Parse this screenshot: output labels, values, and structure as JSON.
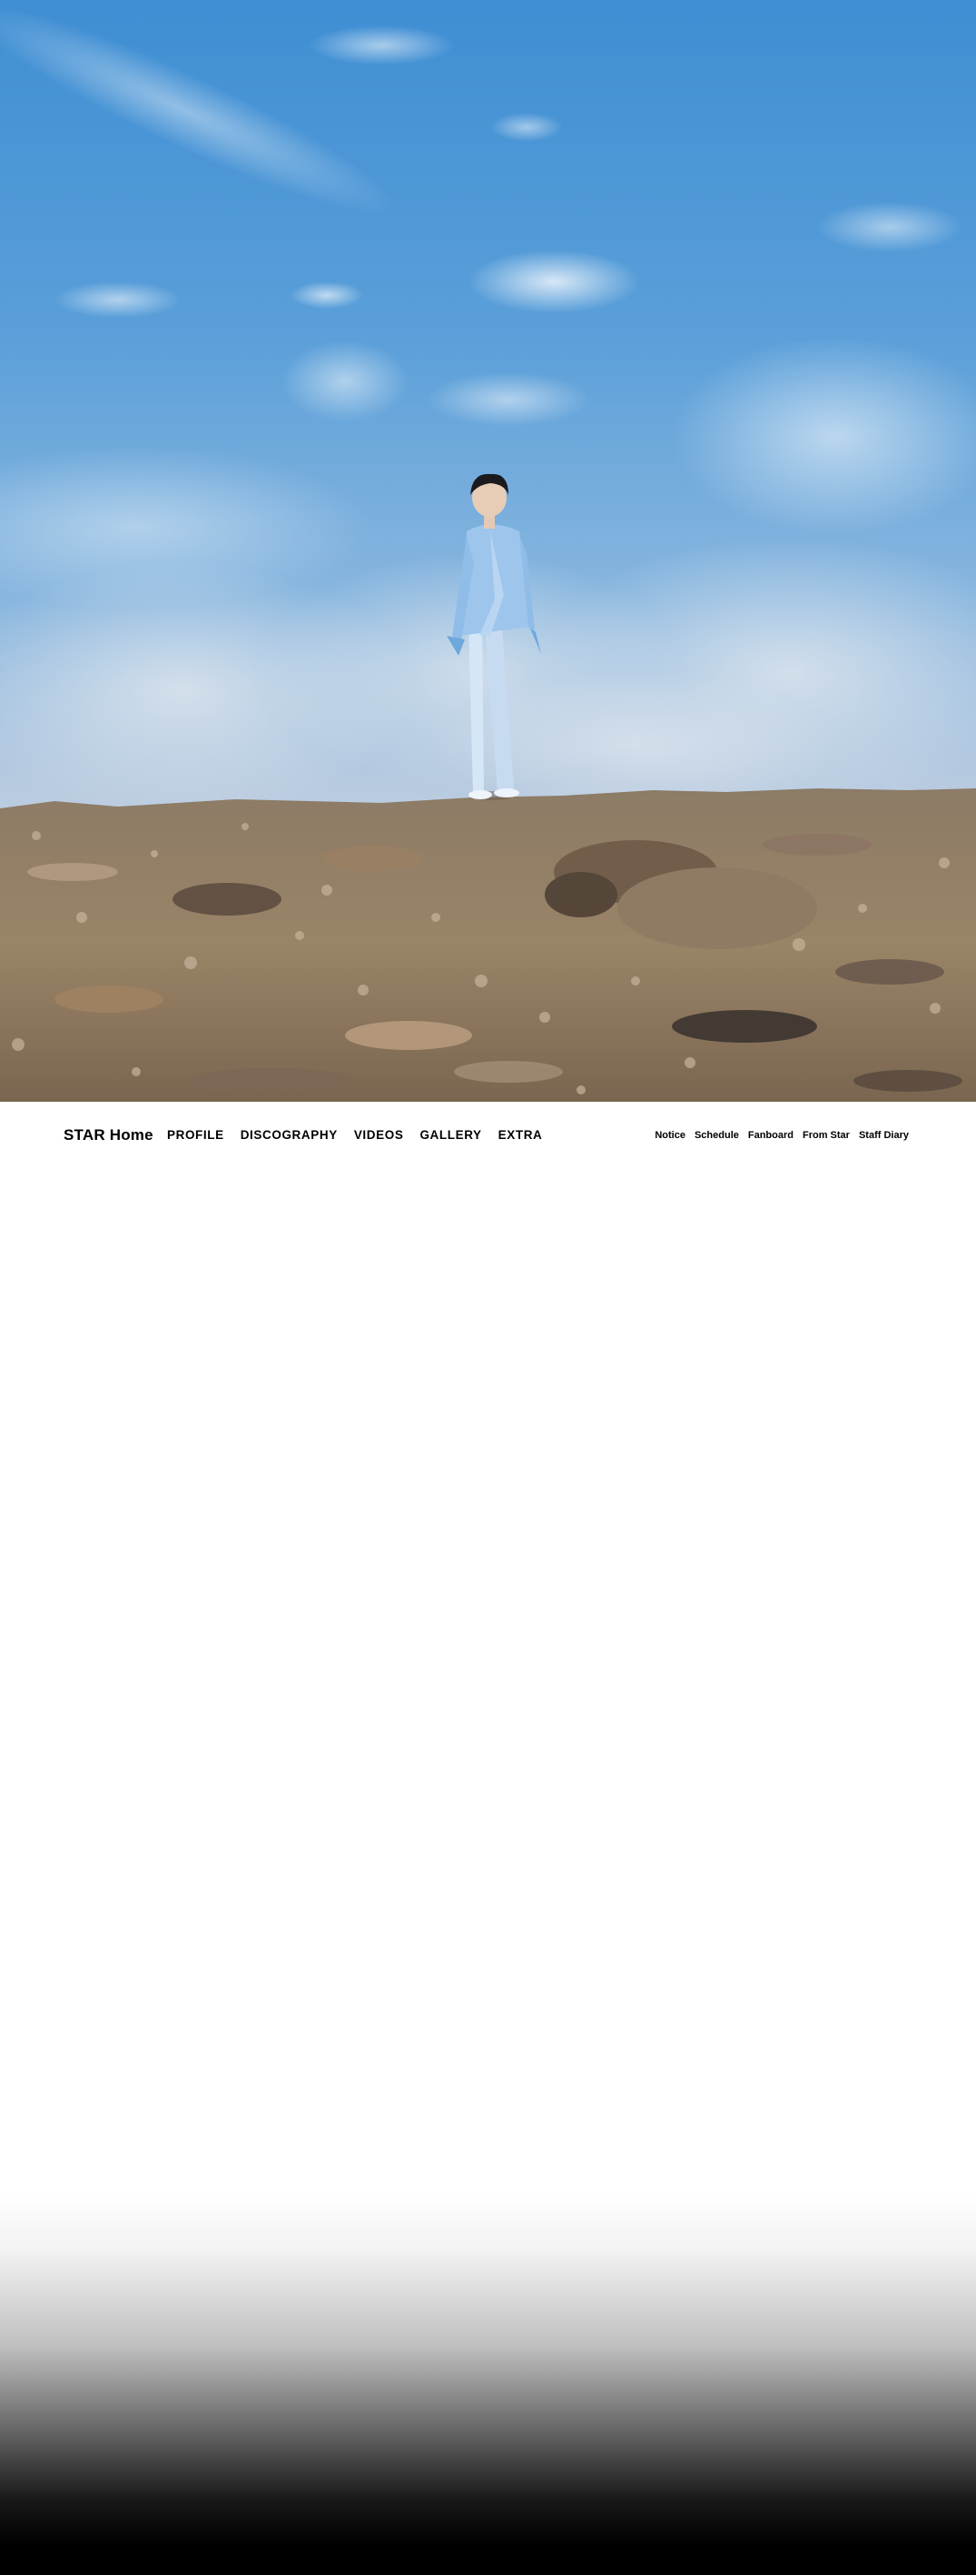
{
  "hero": {
    "image_description_icon": "hero-photo"
  },
  "nav": {
    "brand": "STAR Home",
    "main_items": [
      {
        "label": "PROFILE"
      },
      {
        "label": "DISCOGRAPHY"
      },
      {
        "label": "VIDEOS"
      },
      {
        "label": "GALLERY"
      },
      {
        "label": "EXTRA"
      }
    ],
    "sub_items": [
      {
        "label": "Notice"
      },
      {
        "label": "Schedule"
      },
      {
        "label": "Fanboard"
      },
      {
        "label": "From Star"
      },
      {
        "label": "Staff Diary"
      }
    ]
  },
  "colors": {
    "sky_top": "#3f8ed3",
    "sky_bottom": "#c9d3df",
    "nav_text": "#000000",
    "page_bg": "#ffffff",
    "bottom_fade": "#000000"
  }
}
